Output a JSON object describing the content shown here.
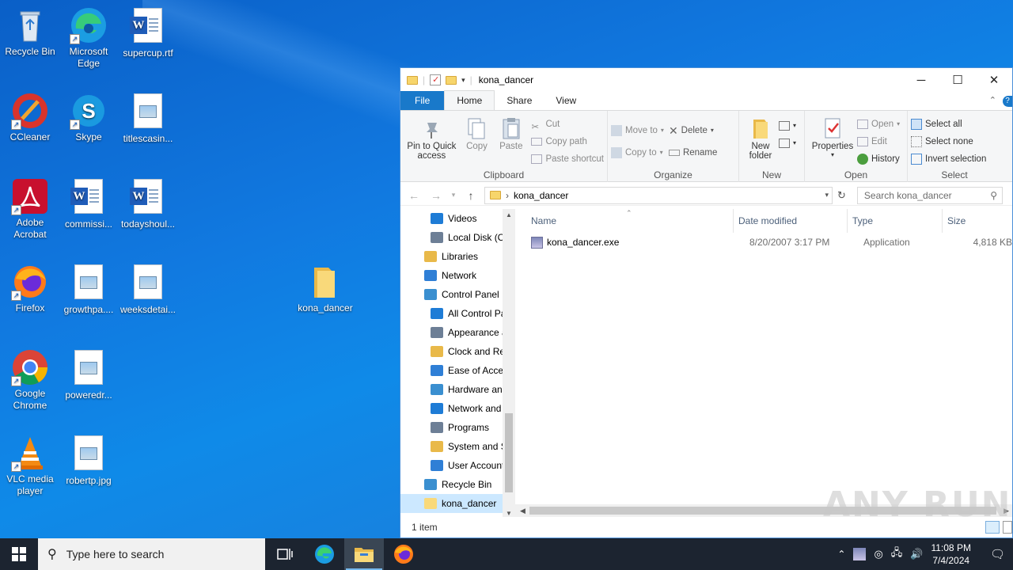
{
  "desktop": {
    "icons": [
      {
        "label": "Recycle Bin",
        "icon": "recycle-bin-icon"
      },
      {
        "label": "Microsoft Edge",
        "icon": "edge-icon"
      },
      {
        "label": "supercup.rtf",
        "icon": "word-doc-icon"
      },
      {
        "label": "CCleaner",
        "icon": "ccleaner-icon"
      },
      {
        "label": "Skype",
        "icon": "skype-icon"
      },
      {
        "label": "titlescasin...",
        "icon": "image-file-icon"
      },
      {
        "label": "Adobe Acrobat",
        "icon": "acrobat-icon"
      },
      {
        "label": "commissi...",
        "icon": "word-doc-icon"
      },
      {
        "label": "todayshoul...",
        "icon": "word-doc-icon"
      },
      {
        "label": "Firefox",
        "icon": "firefox-icon"
      },
      {
        "label": "growthpa....",
        "icon": "image-file-icon"
      },
      {
        "label": "weeksdetai...",
        "icon": "image-file-icon"
      },
      {
        "label": "kona_dancer",
        "icon": "folder-icon"
      },
      {
        "label": "Google Chrome",
        "icon": "chrome-icon"
      },
      {
        "label": "poweredr...",
        "icon": "image-file-icon"
      },
      {
        "label": "VLC media player",
        "icon": "vlc-icon"
      },
      {
        "label": "robertp.jpg",
        "icon": "image-file-icon"
      }
    ]
  },
  "explorer": {
    "title": "kona_dancer",
    "tabs": [
      "File",
      "Home",
      "Share",
      "View"
    ],
    "ribbon": {
      "clipboard": {
        "label": "Clipboard",
        "pin": "Pin to Quick access",
        "copy": "Copy",
        "paste": "Paste",
        "cut": "Cut",
        "copy_path": "Copy path",
        "paste_shortcut": "Paste shortcut"
      },
      "organize": {
        "label": "Organize",
        "move_to": "Move to",
        "copy_to": "Copy to",
        "delete": "Delete",
        "rename": "Rename"
      },
      "new": {
        "label": "New",
        "new_folder": "New folder"
      },
      "open": {
        "label": "Open",
        "properties": "Properties",
        "open": "Open",
        "edit": "Edit",
        "history": "History"
      },
      "select": {
        "label": "Select",
        "select_all": "Select all",
        "select_none": "Select none",
        "invert": "Invert selection"
      }
    },
    "address": {
      "crumb": "kona_dancer",
      "search_placeholder": "Search kona_dancer"
    },
    "tree": [
      {
        "label": "Videos",
        "indent": 2
      },
      {
        "label": "Local Disk (C:)",
        "indent": 2
      },
      {
        "label": "Libraries",
        "indent": 1
      },
      {
        "label": "Network",
        "indent": 1
      },
      {
        "label": "Control Panel",
        "indent": 1
      },
      {
        "label": "All Control Par",
        "indent": 2
      },
      {
        "label": "Appearance an",
        "indent": 2
      },
      {
        "label": "Clock and Regi",
        "indent": 2
      },
      {
        "label": "Ease of Access",
        "indent": 2
      },
      {
        "label": "Hardware and",
        "indent": 2
      },
      {
        "label": "Network and Ir",
        "indent": 2
      },
      {
        "label": "Programs",
        "indent": 2
      },
      {
        "label": "System and Sec",
        "indent": 2
      },
      {
        "label": "User Accounts",
        "indent": 2
      },
      {
        "label": "Recycle Bin",
        "indent": 1
      },
      {
        "label": "kona_dancer",
        "indent": 1,
        "selected": true
      }
    ],
    "columns": {
      "name": "Name",
      "date": "Date modified",
      "type": "Type",
      "size": "Size"
    },
    "files": [
      {
        "name": "kona_dancer.exe",
        "date": "8/20/2007 3:17 PM",
        "type": "Application",
        "size": "4,818 KB"
      }
    ],
    "status": "1 item"
  },
  "watermark": "ANY RUN",
  "taskbar": {
    "search_placeholder": "Type here to search",
    "time": "11:08 PM",
    "date": "7/4/2024"
  }
}
